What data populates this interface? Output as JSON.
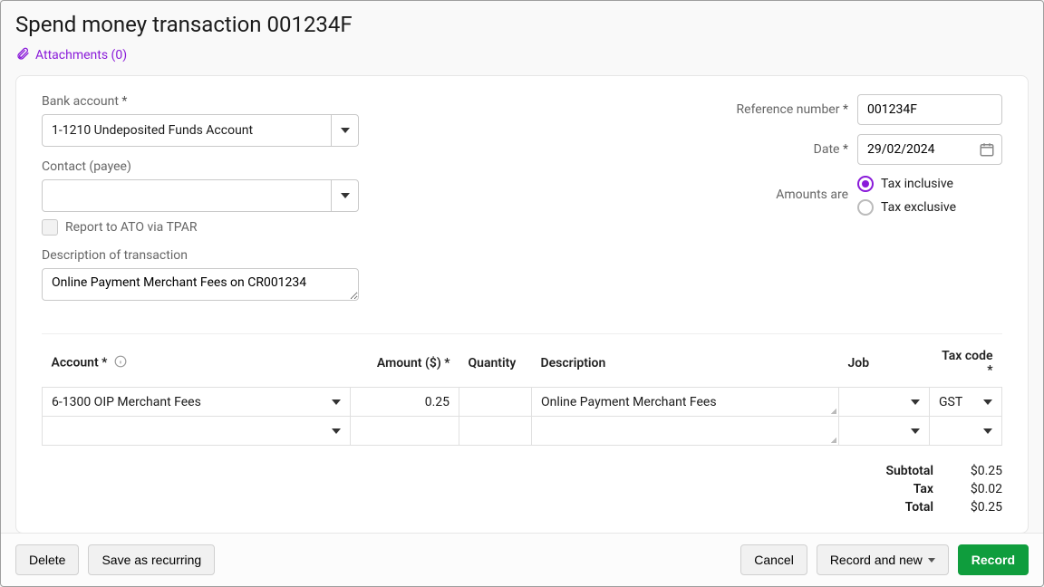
{
  "header": {
    "title": "Spend money transaction 001234F",
    "attachments_label": "Attachments (0)"
  },
  "form": {
    "bank_account": {
      "label": "Bank account",
      "value": "1-1210  Undeposited Funds Account"
    },
    "contact_payee": {
      "label": "Contact (payee)",
      "value": ""
    },
    "tpar": {
      "label": "Report to ATO via TPAR",
      "checked": false
    },
    "description": {
      "label": "Description of transaction",
      "value": "Online Payment Merchant Fees on CR001234"
    },
    "reference": {
      "label": "Reference number",
      "value": "001234F"
    },
    "date": {
      "label": "Date",
      "value": "29/02/2024"
    },
    "amounts_are": {
      "label": "Amounts are",
      "options": {
        "inclusive": "Tax inclusive",
        "exclusive": "Tax exclusive"
      },
      "selected": "inclusive"
    }
  },
  "table": {
    "headers": {
      "account": "Account *",
      "amount": "Amount ($) *",
      "quantity": "Quantity",
      "description": "Description",
      "job": "Job",
      "tax_code": "Tax code *"
    },
    "rows": [
      {
        "account": "6-1300  OIP Merchant Fees",
        "amount": "0.25",
        "quantity": "",
        "description": "Online Payment Merchant Fees",
        "job": "",
        "tax_code": "GST"
      },
      {
        "account": "",
        "amount": "",
        "quantity": "",
        "description": "",
        "job": "",
        "tax_code": ""
      }
    ]
  },
  "totals": {
    "subtotal": {
      "label": "Subtotal",
      "value": "$0.25"
    },
    "tax": {
      "label": "Tax",
      "value": "$0.02"
    },
    "total": {
      "label": "Total",
      "value": "$0.25"
    }
  },
  "actions": {
    "delete": "Delete",
    "save_recurring": "Save as recurring",
    "cancel": "Cancel",
    "record_and_new": "Record and new",
    "record": "Record"
  },
  "colors": {
    "accent": "#8a1bd9",
    "primary": "#0f9d3d"
  }
}
